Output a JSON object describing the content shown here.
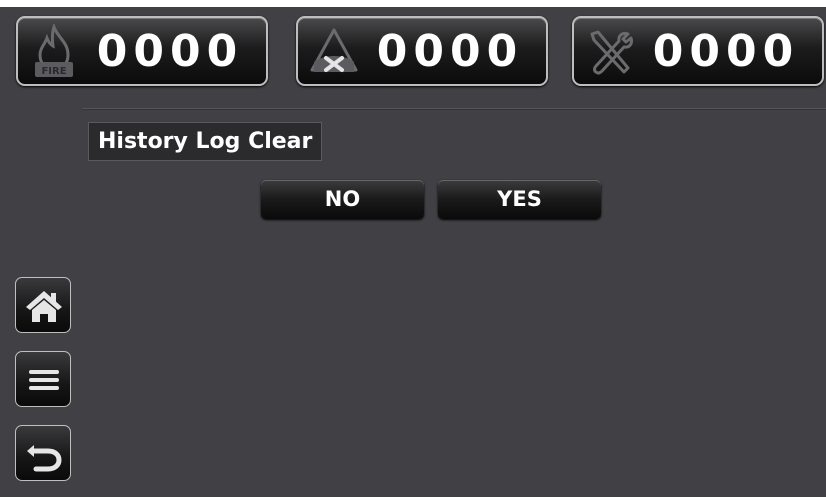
{
  "counters": [
    {
      "icon": "fire-icon",
      "value": "0000"
    },
    {
      "icon": "fault-icon",
      "value": "0000"
    },
    {
      "icon": "maintenance-icon",
      "value": "0000"
    }
  ],
  "dialog": {
    "title": "History Log Clear",
    "no_label": "NO",
    "yes_label": "YES"
  },
  "side_nav": [
    "home-icon",
    "menu-icon",
    "back-icon"
  ],
  "colors": {
    "background": "#414145",
    "button": "#111112",
    "text": "#ffffff"
  }
}
